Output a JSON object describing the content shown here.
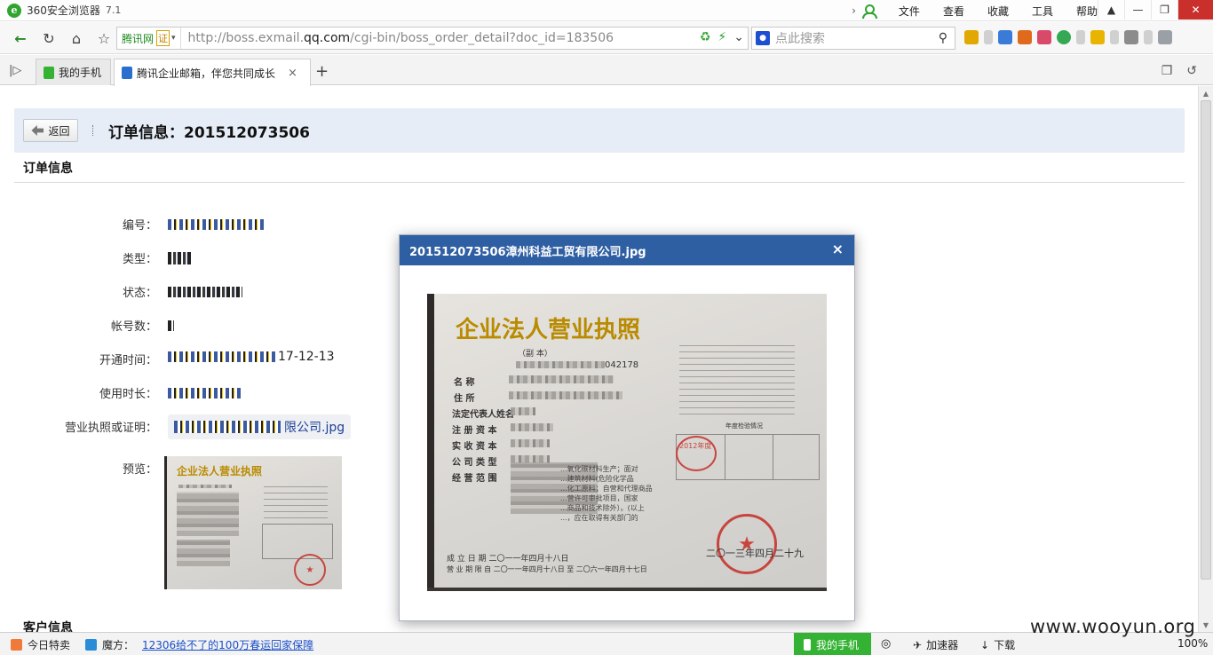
{
  "browser": {
    "app_name": "360安全浏览器",
    "app_version": "7.1",
    "menu": [
      "文件",
      "查看",
      "收藏",
      "工具",
      "帮助"
    ],
    "cert_label": "腾讯网",
    "cert_badge": "证",
    "url_prefix": "http://boss.exmail.",
    "url_host": "qq.com",
    "url_path": "/cgi-bin/boss_order_detail?doc_id=183506",
    "search_placeholder": "点此搜索",
    "tabs": [
      {
        "label": "我的手机"
      },
      {
        "label": "腾讯企业邮箱，伴您共同成长"
      }
    ],
    "tab_close": "×",
    "tab_add": "+"
  },
  "page": {
    "back_label": "返回",
    "order_title": "订单信息：201512073506",
    "section_title": "订单信息",
    "fields": [
      {
        "label": "编号：",
        "value": ""
      },
      {
        "label": "类型：",
        "value": ""
      },
      {
        "label": "状态：",
        "value": ""
      },
      {
        "label": "帐号数：",
        "value": ""
      },
      {
        "label": "开通时间：",
        "value": "17-12-13"
      },
      {
        "label": "使用时长：",
        "value": ""
      },
      {
        "label": "营业执照或证明：",
        "value": "限公司.jpg"
      },
      {
        "label": "预览：",
        "value": ""
      }
    ],
    "customer_section": "客户信息"
  },
  "license_doc": {
    "title": "企业法人营业执照",
    "copy_mark": "（副  本）",
    "reg_no_suffix": "042178",
    "row_labels": [
      "名      称",
      "住      所",
      "法定代表人姓名",
      "注 册 资 本",
      "实 收 资 本",
      "公 司 类 型",
      "经 营 范 围"
    ],
    "scope_text": [
      "...氧化碳材料生产；面对",
      "...建筑材料(危险化学品",
      "...化工原料；自营和代理商品",
      "...营许可审批项目，国家",
      "...商品和技术除外）。(以上",
      "...，应在取得有关部门的"
    ],
    "annual_label": "年度检验情况",
    "date_row": "成 立 日 期        二〇一一年四月十八日",
    "term_row": "营 业 期 限    自 二〇一一年四月十八日    至 二〇六一年四月十七日",
    "issue_date": "二〇一三年四月二十九",
    "stamp_year": "2012年度"
  },
  "modal": {
    "title": "201512073506漳州科益工贸有限公司.jpg",
    "close": "×"
  },
  "statusbar": {
    "today": "今日特卖",
    "magic": "魔方：",
    "ad_link": "12306给不了的100万春运回家保障",
    "my_phone": "我的手机",
    "accelerator": "加速器",
    "download": "下载",
    "zoom": "100%"
  },
  "watermark": "www.wooyun.org",
  "colors": {
    "modal_header": "#2f5fa3",
    "header_bg": "#e6edf6",
    "link": "#1d3f99",
    "phone_green": "#34b233",
    "seal_red": "#c8453f",
    "doc_gold": "#b98b00"
  }
}
